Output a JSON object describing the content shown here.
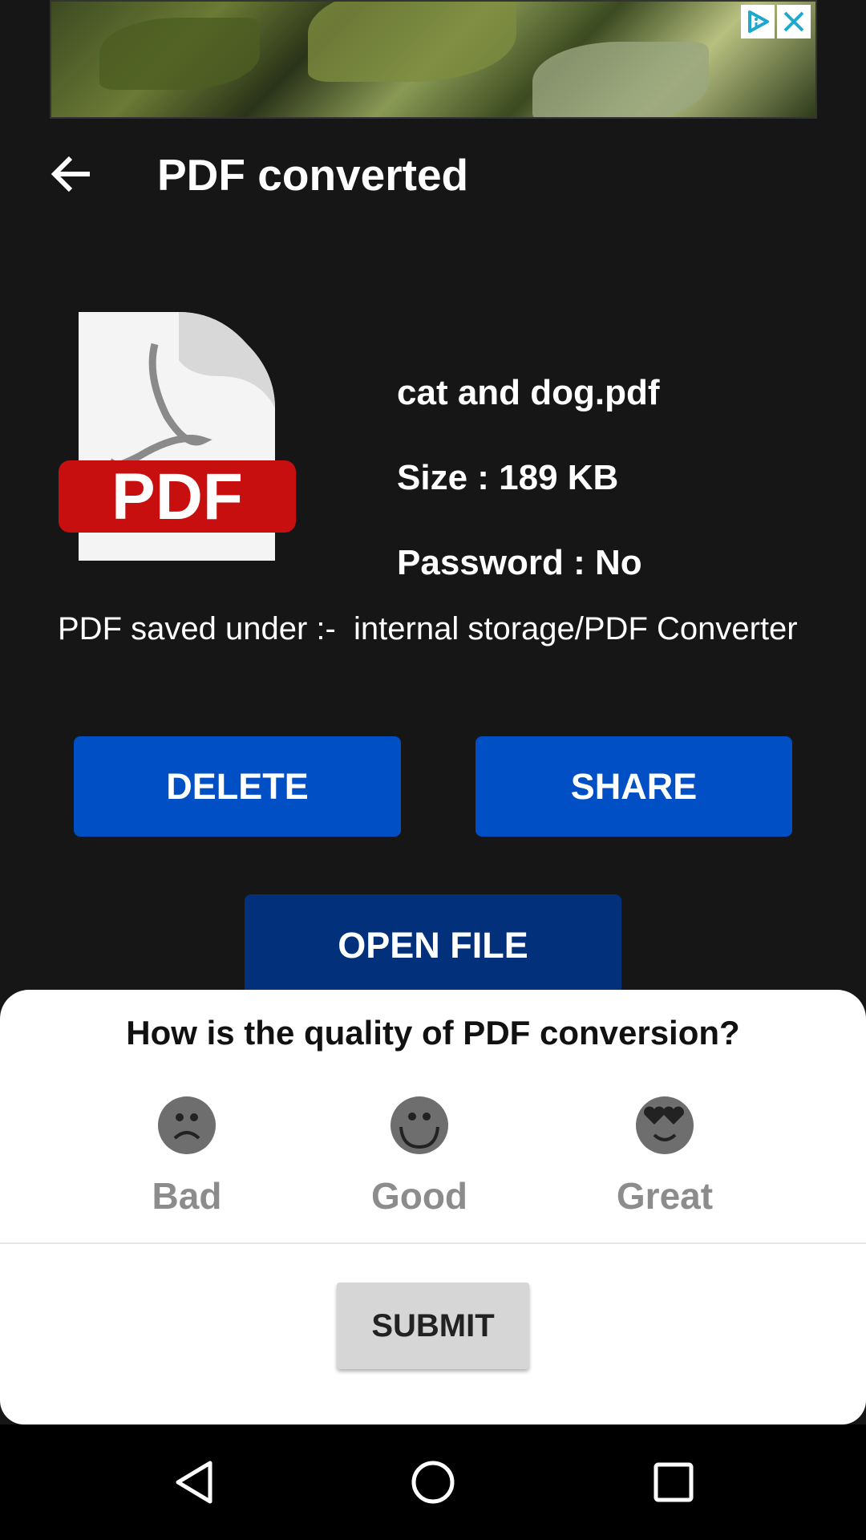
{
  "ad": {
    "adchoices_icon": "adchoices-icon",
    "close_icon": "close-icon"
  },
  "header": {
    "title": "PDF converted",
    "back_icon": "arrow-left-icon"
  },
  "file": {
    "icon_label": "PDF",
    "name": "cat and dog.pdf",
    "size": "Size : 189 KB",
    "password": "Password : No"
  },
  "saved_under": "PDF saved under :-  internal storage/PDF Converter",
  "buttons": {
    "delete": "DELETE",
    "share": "SHARE",
    "open": "OPEN FILE"
  },
  "rating": {
    "question": "How is the quality of PDF conversion?",
    "options": [
      {
        "label": "Bad",
        "icon": "sad-face-icon"
      },
      {
        "label": "Good",
        "icon": "smile-face-icon"
      },
      {
        "label": "Great",
        "icon": "heart-eyes-face-icon"
      }
    ],
    "submit": "SUBMIT"
  },
  "colors": {
    "primary": "#004fc4",
    "open_file": "#03307a",
    "face": "#6e6e6e"
  }
}
